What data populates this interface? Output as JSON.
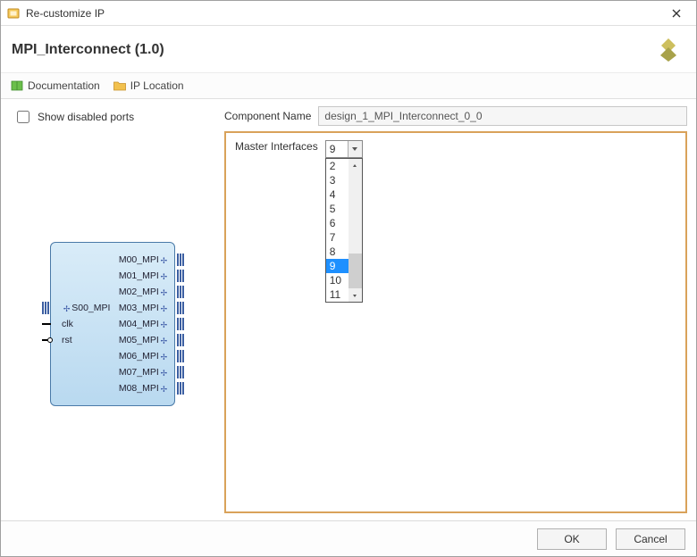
{
  "window": {
    "title": "Re-customize IP"
  },
  "header": {
    "title": "MPI_Interconnect (1.0)"
  },
  "toolbar": {
    "doc_label": "Documentation",
    "iploc_label": "IP Location"
  },
  "left": {
    "show_disabled_label": "Show disabled ports",
    "slave_ports": [
      "S00_MPI",
      "clk",
      "rst"
    ],
    "master_ports": [
      "M00_MPI",
      "M01_MPI",
      "M02_MPI",
      "M03_MPI",
      "M04_MPI",
      "M05_MPI",
      "M06_MPI",
      "M07_MPI",
      "M08_MPI"
    ]
  },
  "right": {
    "component_name_label": "Component Name",
    "component_name_value": "design_1_MPI_Interconnect_0_0",
    "master_if_label": "Master Interfaces",
    "master_if_value": "9",
    "master_if_options": [
      "2",
      "3",
      "4",
      "5",
      "6",
      "7",
      "8",
      "9",
      "10",
      "11"
    ],
    "master_if_selected": "9"
  },
  "footer": {
    "ok_label": "OK",
    "cancel_label": "Cancel"
  }
}
